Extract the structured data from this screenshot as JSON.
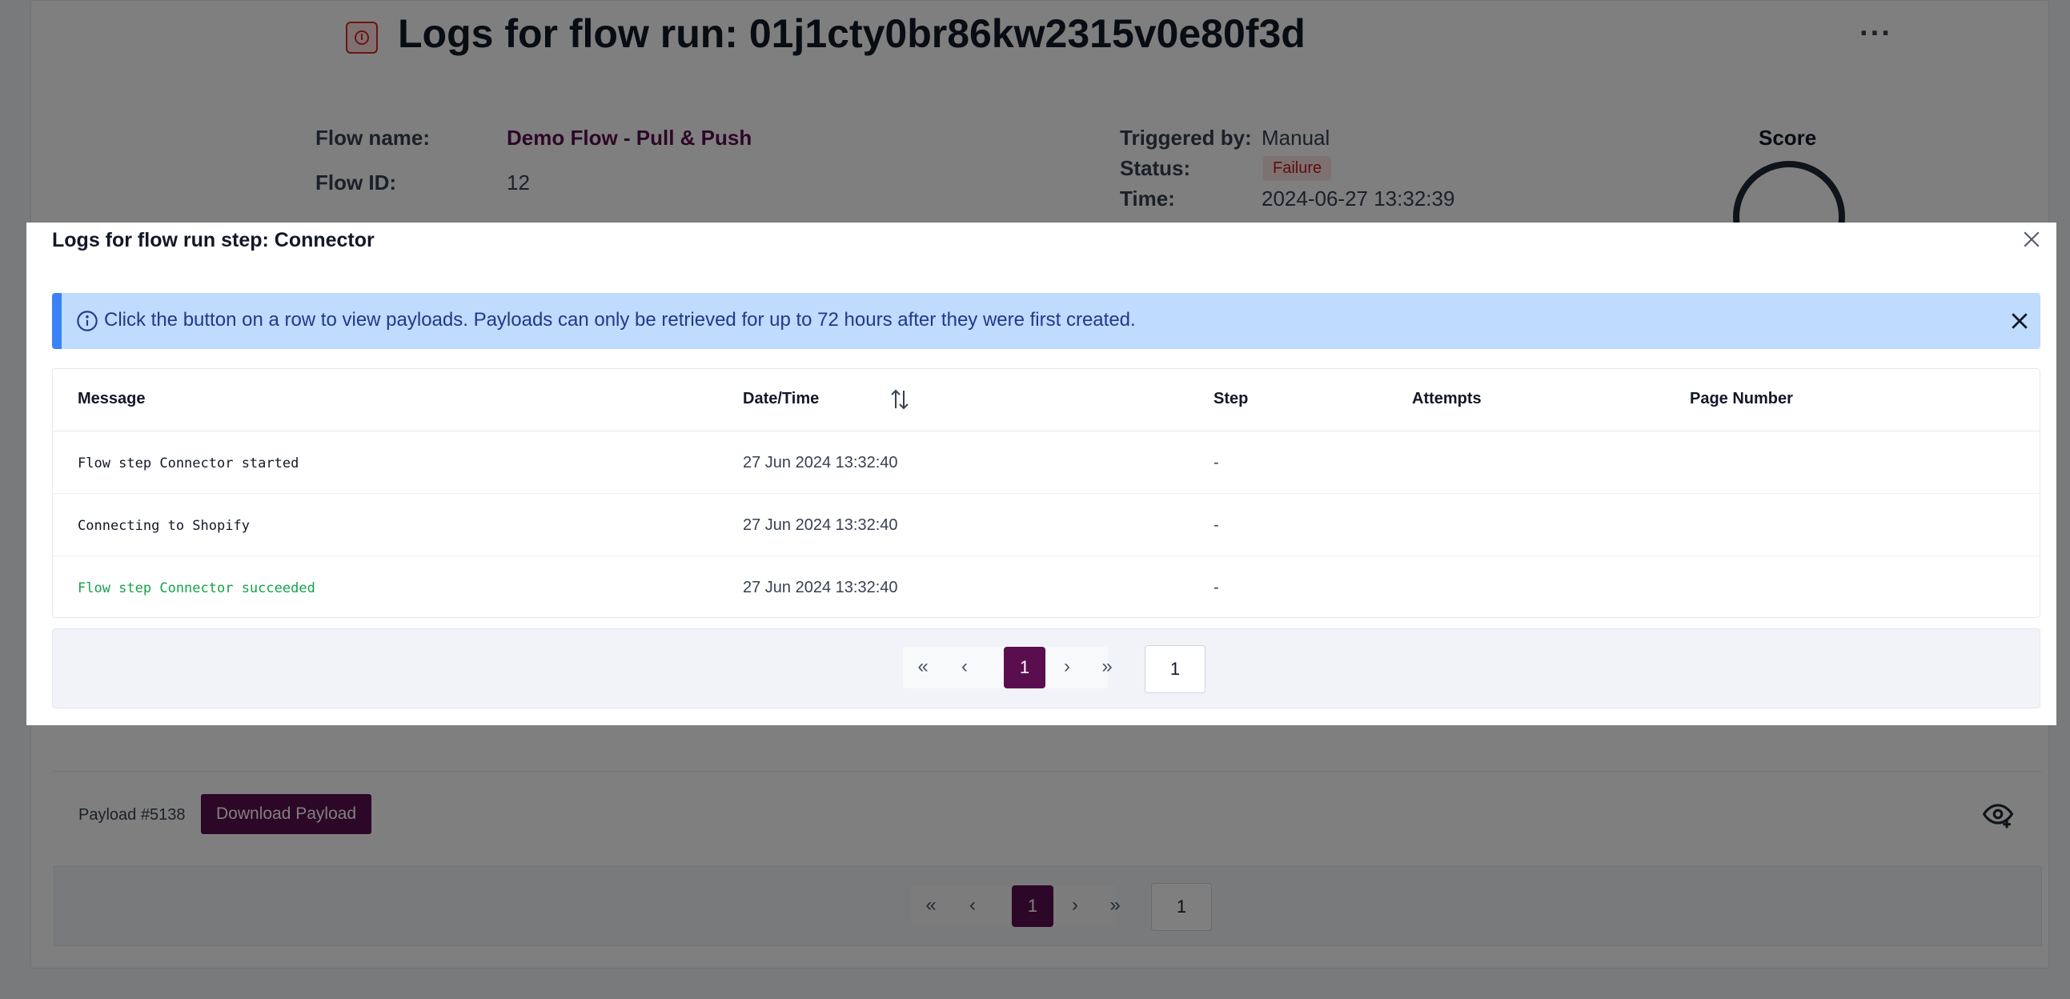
{
  "page": {
    "title": "Logs for flow run: 01j1cty0br86kw2315v0e80f3d",
    "more_label": "···",
    "flow_name_label": "Flow name:",
    "flow_name": "Demo Flow - Pull & Push",
    "flow_id_label": "Flow ID:",
    "flow_id": "12",
    "triggered_by_label": "Triggered by:",
    "triggered_by": "Manual",
    "status_label": "Status:",
    "status": "Failure",
    "time_label": "Time:",
    "time": "2024-06-27 13:32:39",
    "score_label": "Score",
    "payload_label": "Payload #5138",
    "download_label": "Download Payload",
    "pager_current": "1",
    "pager_input": "1"
  },
  "modal": {
    "title": "Logs for flow run step: Connector",
    "alert": "Click the button on a row to view payloads. Payloads can only be retrieved for up to 72 hours after they were first created.",
    "columns": {
      "message": "Message",
      "datetime": "Date/Time",
      "step": "Step",
      "attempts": "Attempts",
      "page_number": "Page Number"
    },
    "rows": [
      {
        "message": "Flow step Connector started",
        "datetime": "27 Jun 2024 13:32:40",
        "step": "-"
      },
      {
        "message": "Connecting to Shopify",
        "datetime": "27 Jun 2024 13:32:40",
        "step": "-"
      },
      {
        "message": "Flow step Connector succeeded",
        "datetime": "27 Jun 2024 13:32:40",
        "step": "-",
        "status": "success"
      }
    ],
    "pager": {
      "first": "«",
      "prev": "‹",
      "current": "1",
      "next": "›",
      "last": "»",
      "input": "1"
    }
  },
  "colors": {
    "brand": "#5b0e4f",
    "success": "#16a34a",
    "failure": "#b91c1c",
    "info_bg": "#bfdbfe",
    "info_border": "#3b82f6"
  }
}
